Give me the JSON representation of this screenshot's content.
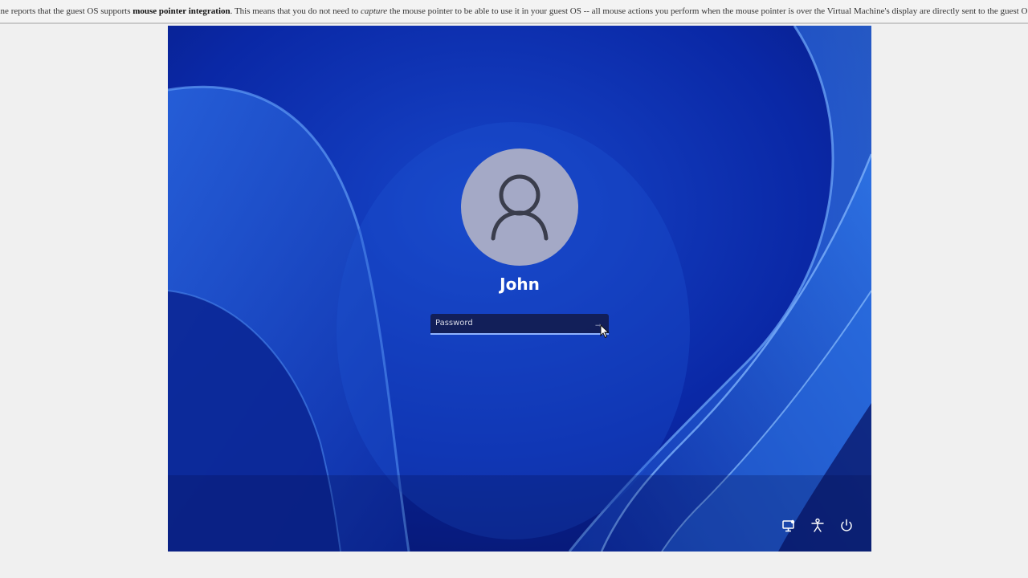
{
  "notice": {
    "prefix": "hine reports that the guest OS supports ",
    "bold": "mouse pointer integration",
    "middle": ". This means that you do not need to ",
    "italic": "capture",
    "suffix": " the mouse pointer to be able to use it in your guest OS -- all mouse actions you perform when the mouse pointer is over the Virtual Machine's display are directly sent to the guest OS."
  },
  "lock_screen": {
    "username": "John",
    "password_placeholder": "Password",
    "submit_glyph": "→"
  },
  "bottom_icons": [
    "network-icon",
    "accessibility-icon",
    "power-icon"
  ],
  "colors": {
    "wallpaper_base": "#0a1fa8",
    "avatar_bg": "#a4a9c6",
    "accent_underline": "#8fb3ff"
  }
}
